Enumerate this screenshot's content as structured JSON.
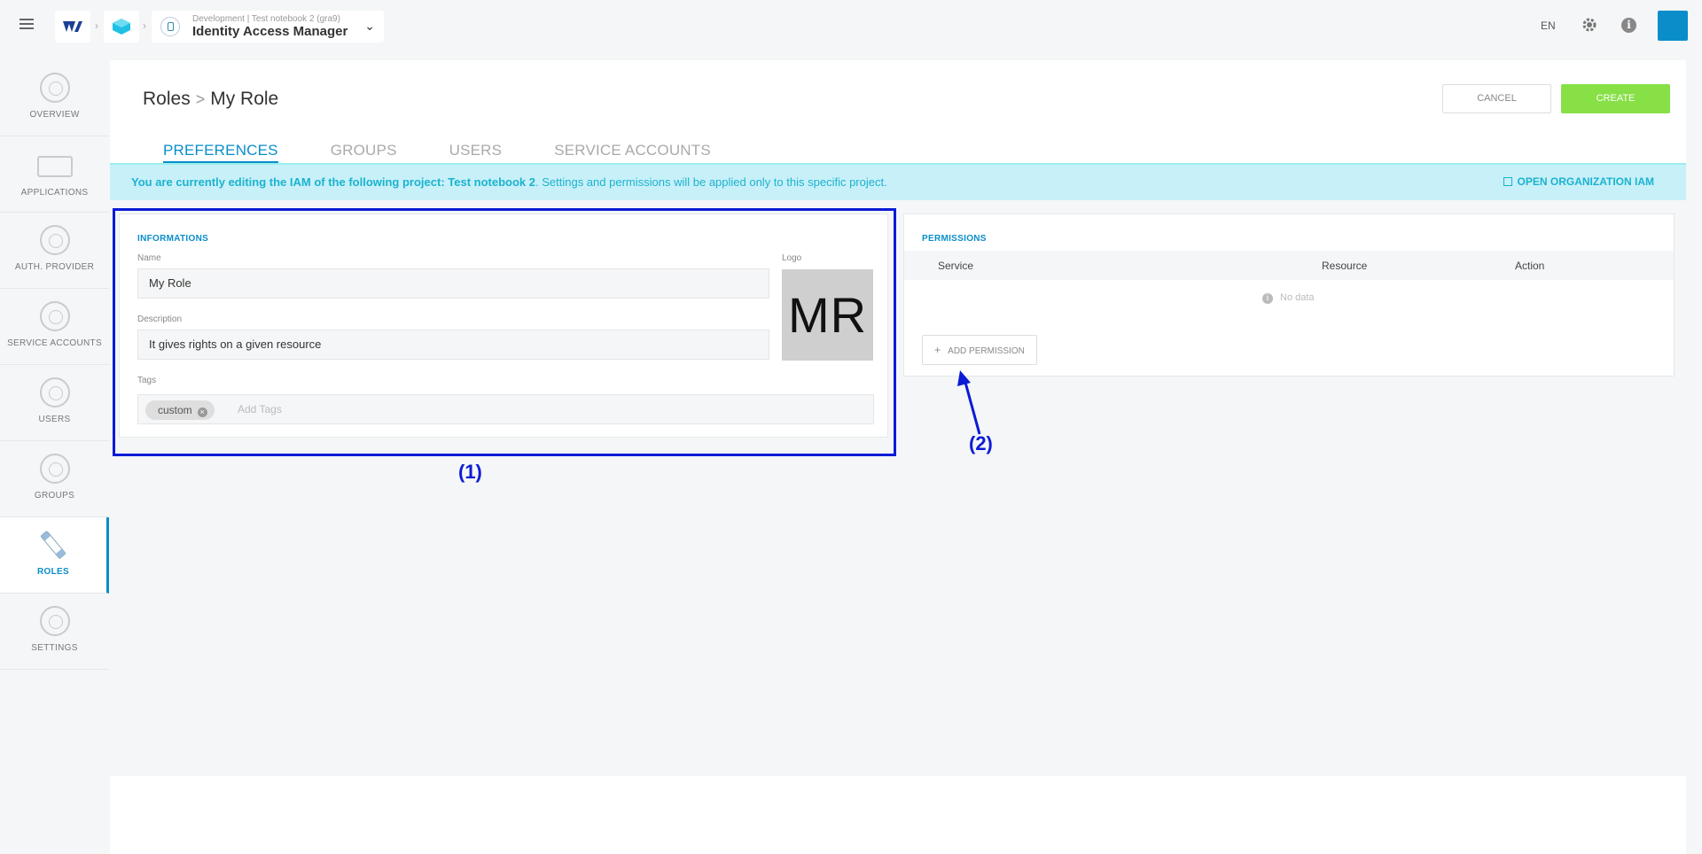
{
  "topbar": {
    "app_subtitle": "Development | Test notebook 2 (gra9)",
    "app_title": "Identity Access Manager",
    "lang": "EN"
  },
  "sidebar": {
    "items": [
      {
        "label": "OVERVIEW",
        "icon": "overview-icon"
      },
      {
        "label": "APPLICATIONS",
        "icon": "laptop-icon"
      },
      {
        "label": "AUTH. PROVIDER",
        "icon": "key-icon"
      },
      {
        "label": "SERVICE ACCOUNTS",
        "icon": "service-accounts-icon"
      },
      {
        "label": "USERS",
        "icon": "users-icon"
      },
      {
        "label": "GROUPS",
        "icon": "groups-icon"
      },
      {
        "label": "ROLES",
        "icon": "pencil-icon",
        "active": true
      },
      {
        "label": "SETTINGS",
        "icon": "settings-icon"
      }
    ]
  },
  "breadcrumb": {
    "parent": "Roles",
    "current": "My Role"
  },
  "actions": {
    "cancel": "CANCEL",
    "create": "CREATE"
  },
  "tabs": [
    {
      "label": "PREFERENCES",
      "active": true
    },
    {
      "label": "GROUPS"
    },
    {
      "label": "USERS"
    },
    {
      "label": "SERVICE ACCOUNTS"
    }
  ],
  "banner": {
    "prefix": "You are currently editing the IAM of the following project: ",
    "project": "Test notebook 2",
    "suffix": ". Settings and permissions will be applied only to this specific project.",
    "link": "OPEN ORGANIZATION IAM"
  },
  "informations": {
    "title": "INFORMATIONS",
    "name_label": "Name",
    "name_value": "My Role",
    "description_label": "Description",
    "description_value": "It gives rights on a given resource",
    "logo_label": "Logo",
    "logo_initials": "MR",
    "tags_label": "Tags",
    "tag": "custom",
    "tags_placeholder": "Add Tags"
  },
  "permissions": {
    "title": "PERMISSIONS",
    "columns": [
      "Service",
      "Resource",
      "Action"
    ],
    "empty": "No data",
    "add_button": "ADD PERMISSION"
  },
  "annotations": {
    "one": "(1)",
    "two": "(2)"
  },
  "colors": {
    "accent": "#0a8dc9",
    "create": "#86e046",
    "annotation": "#0b1bd6",
    "banner": "#c8f0f8"
  }
}
